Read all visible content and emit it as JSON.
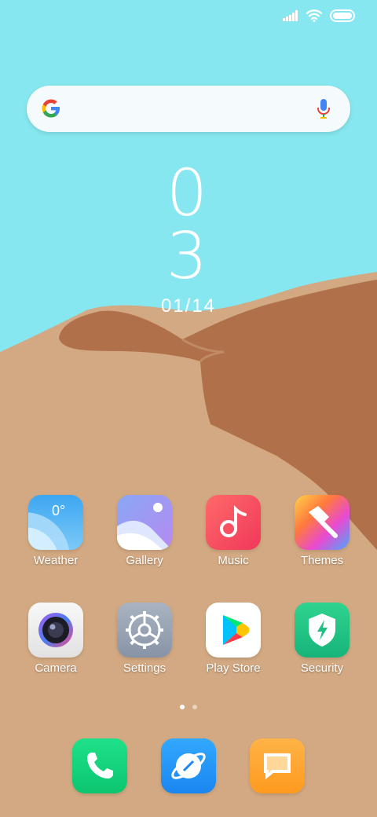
{
  "status_bar": {
    "icons": [
      "signal-icon",
      "wifi-icon",
      "battery-icon"
    ]
  },
  "search": {
    "icons": [
      "google-logo-icon",
      "microphone-icon"
    ]
  },
  "clock": {
    "hours": "0",
    "minutes": "3",
    "date": "01/14"
  },
  "apps": [
    {
      "label": "Weather",
      "icon": "weather-icon",
      "badge": "0°"
    },
    {
      "label": "Gallery",
      "icon": "gallery-icon"
    },
    {
      "label": "Music",
      "icon": "music-icon"
    },
    {
      "label": "Themes",
      "icon": "themes-icon"
    },
    {
      "label": "Camera",
      "icon": "camera-icon"
    },
    {
      "label": "Settings",
      "icon": "settings-icon"
    },
    {
      "label": "Play Store",
      "icon": "play-store-icon"
    },
    {
      "label": "Security",
      "icon": "security-icon"
    }
  ],
  "page_indicator": {
    "pages": 2,
    "current": 1
  },
  "dock": [
    {
      "icon": "phone-icon"
    },
    {
      "icon": "browser-icon"
    },
    {
      "icon": "messages-icon"
    }
  ],
  "colors": {
    "sky": "#87e7f0",
    "sand_light": "#d2a982",
    "sand_dark": "#b0704a"
  }
}
